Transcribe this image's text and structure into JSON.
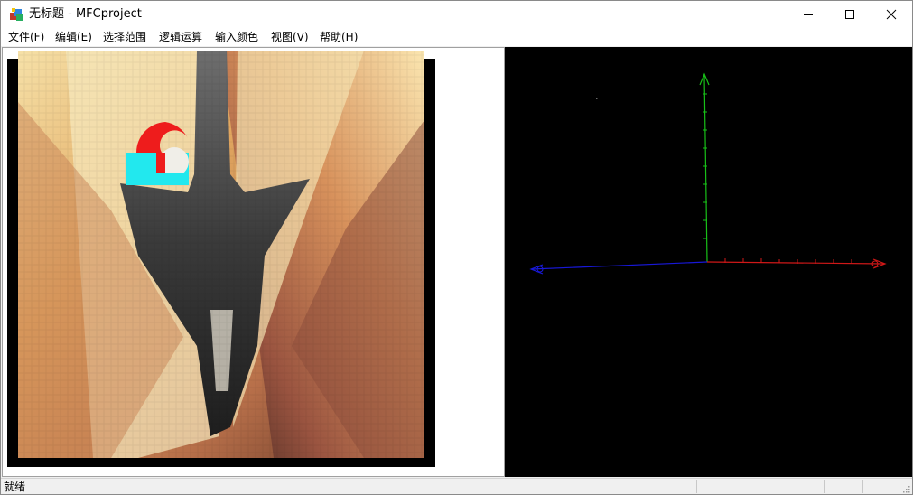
{
  "window": {
    "title": "无标题 - MFCproject"
  },
  "menu": [
    {
      "label": "文件(F)"
    },
    {
      "label": "编辑(E)"
    },
    {
      "label": "选择范围"
    },
    {
      "label": "逻辑运算"
    },
    {
      "label": "输入颜色"
    },
    {
      "label": "视图(V)"
    },
    {
      "label": "帮助(H)"
    }
  ],
  "status": {
    "text": "就绪"
  },
  "colors": {
    "x_axis": "#d01818",
    "y_axis": "#18c018",
    "z_axis": "#1818d8",
    "selection_fill": "#ee1c1c",
    "selection_cut": "#22e8ee",
    "viewport_bg": "#000000"
  },
  "icons": {
    "app": "mfc-app-icon",
    "minimize": "minimize-icon",
    "maximize": "maximize-icon",
    "close": "close-icon"
  }
}
